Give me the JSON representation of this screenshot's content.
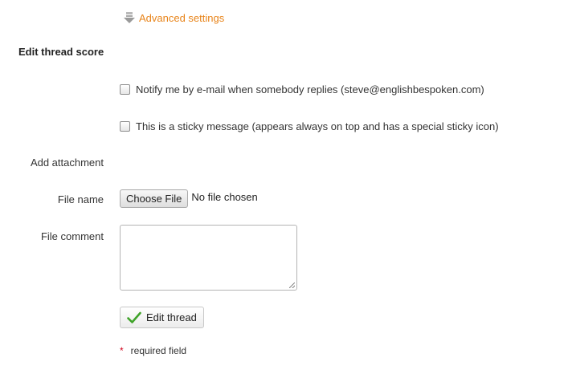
{
  "advanced": {
    "label": "Advanced settings",
    "icon": "arrow-down-icon"
  },
  "section": {
    "title": "Edit thread score"
  },
  "options": {
    "notify_label": "Notify me by e-mail when somebody replies (steve@englishbespoken.com)",
    "sticky_label": "This is a sticky message (appears always on top and has a special sticky icon)"
  },
  "attachment": {
    "heading": "Add attachment",
    "file_name_label": "File name",
    "choose_file_label": "Choose File",
    "file_status": "No file chosen",
    "file_comment_label": "File comment",
    "file_comment_value": ""
  },
  "submit": {
    "label": "Edit thread",
    "icon": "checkmark-icon"
  },
  "required": {
    "marker": "*",
    "text": "required field"
  },
  "colors": {
    "link": "#e8841a",
    "required_marker": "#d0021b",
    "check": "#3fa329"
  }
}
